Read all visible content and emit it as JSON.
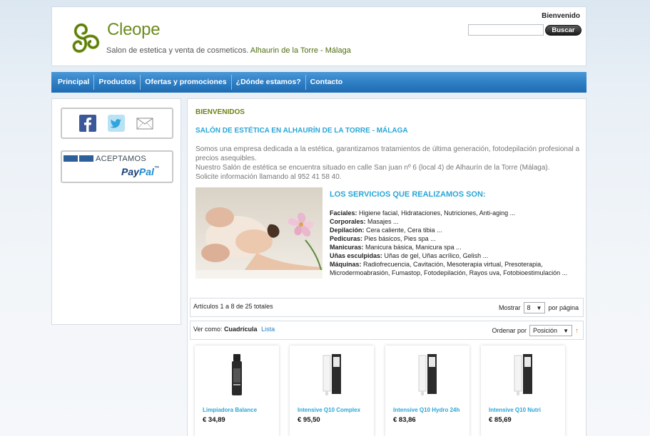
{
  "header": {
    "brand": "Cleope",
    "tagline": "Salon de estetica y venta de cosmeticos.",
    "location": "Alhaurin de la Torre - Málaga",
    "welcome": "Bienvenido",
    "search_placeholder": "",
    "search_button": "Buscar"
  },
  "nav": {
    "items": [
      {
        "label": "Principal"
      },
      {
        "label": "Productos"
      },
      {
        "label": "Ofertas y promociones"
      },
      {
        "label": "¿Dónde estamos?"
      },
      {
        "label": "Contacto"
      }
    ]
  },
  "sidebar": {
    "social": [
      "facebook-icon",
      "twitter-icon",
      "mail-icon"
    ],
    "paypal_accept": "ACEPTAMOS",
    "paypal_logo_pay": "Pay",
    "paypal_logo_pal": "Pal"
  },
  "main": {
    "welcome_heading": "BIENVENIDOS",
    "salon_heading": "SALÓN DE ESTÉTICA EN ALHAURÍN DE LA TORRE - MÁLAGA",
    "intro_line1": "Somos una empresa dedicada a la estética, garantizamos tratamientos de última generación, fotodepilación profesional a precios asequibles.",
    "intro_line2": "Nuestro Salón de estética se encuentra situado en calle San juan nº 6 (local 4) de Alhaurín de la Torre (Málaga).",
    "intro_line3": "Solicite información llamando al 952 41 58 40.",
    "services_heading": "LOS SERVICIOS QUE REALIZAMOS SON:",
    "services": [
      {
        "label": "Faciales:",
        "text": " Higiene facial, Hidrataciones, Nutriciones, Anti-aging ..."
      },
      {
        "label": "Corporales:",
        "text": " Masajes ..."
      },
      {
        "label": "Depilación:",
        "text": " Cera caliente, Cera tibia ..."
      },
      {
        "label": "Pedicuras:",
        "text": " Pies básicos, Pies spa ..."
      },
      {
        "label": "Manicuras:",
        "text": " Manicura básica, Manicura spa ..."
      },
      {
        "label": "Uñas esculpidas:",
        "text": " Uñas de gel, Uñas acrílico, Gelish ..."
      },
      {
        "label": "Máquinas:",
        "text": " Radiofrecuencia, Cavitación, Mesoterapia virtual, Presoterapia, Microdermoabrasión, Fumastop, Fotodepilación, Rayos uva, Fotobioestimulación ..."
      }
    ]
  },
  "toolbar": {
    "count_text": "Artículos 1 a 8 de 25 totales",
    "show_label": "Mostrar",
    "show_value": "8",
    "per_page": "por página",
    "view_label": "Ver como:",
    "view_grid": "Cuadrícula",
    "view_list": "Lista",
    "sort_label": "Ordenar por",
    "sort_value": "Posición"
  },
  "products": [
    {
      "name": "Limpiadora Balance",
      "price": "€ 34,89",
      "icon": "dark-bottle"
    },
    {
      "name": "Intensive Q10 Complex",
      "price": "€ 95,50",
      "icon": "white-tube"
    },
    {
      "name": "Intensive Q10 Hydro 24h",
      "price": "€ 83,86",
      "icon": "white-tube"
    },
    {
      "name": "Intensive Q10 Nutri",
      "price": "€ 85,69",
      "icon": "white-tube"
    }
  ],
  "colors": {
    "nav_blue": "#2f7fc5",
    "heading_olive": "#6f8113",
    "heading_cyan": "#29a6d7",
    "brand_green": "#6c8b1f"
  }
}
